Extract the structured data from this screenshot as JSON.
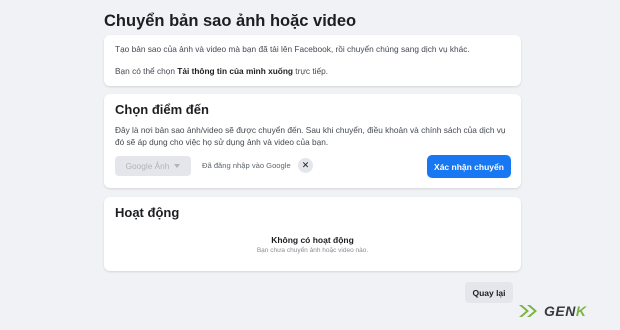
{
  "page": {
    "title": "Chuyển bản sao ảnh hoặc video"
  },
  "intro": {
    "line1": "Tạo bản sao của ảnh và video mà bạn đã tải lên Facebook, rồi chuyển chúng sang dịch vụ khác.",
    "line2_prefix": "Bạn có thể chọn ",
    "line2_bold": "Tải thông tin của mình xuống",
    "line2_suffix": " trực tiếp."
  },
  "destination": {
    "heading": "Chọn điểm đến",
    "description": "Đây là nơi bản sao ảnh/video sẽ được chuyển đến. Sau khi chuyển, điều khoản và chính sách của dịch vụ đó sẽ áp dụng cho việc họ sử dụng ảnh và video của bạn.",
    "select_value": "Google Ảnh",
    "logged_in_text": "Đã đăng nhập vào Google",
    "close_symbol": "✕",
    "confirm_label": "Xác nhận chuyển"
  },
  "activity": {
    "heading": "Hoạt động",
    "empty_title": "Không có hoạt động",
    "empty_subtitle": "Bạn chưa chuyển ảnh hoặc video nào."
  },
  "footer": {
    "back_label": "Quay lại"
  },
  "watermark": {
    "brand_prefix": "GEN",
    "brand_accent": "K"
  },
  "colors": {
    "primary": "#1877f2",
    "background": "#f0f2f5",
    "card": "#ffffff",
    "watermark_accent": "#7cb342"
  },
  "icons": {
    "select_caret": "caret-down-icon",
    "close": "close-icon",
    "watermark": "double-arrow-icon"
  }
}
